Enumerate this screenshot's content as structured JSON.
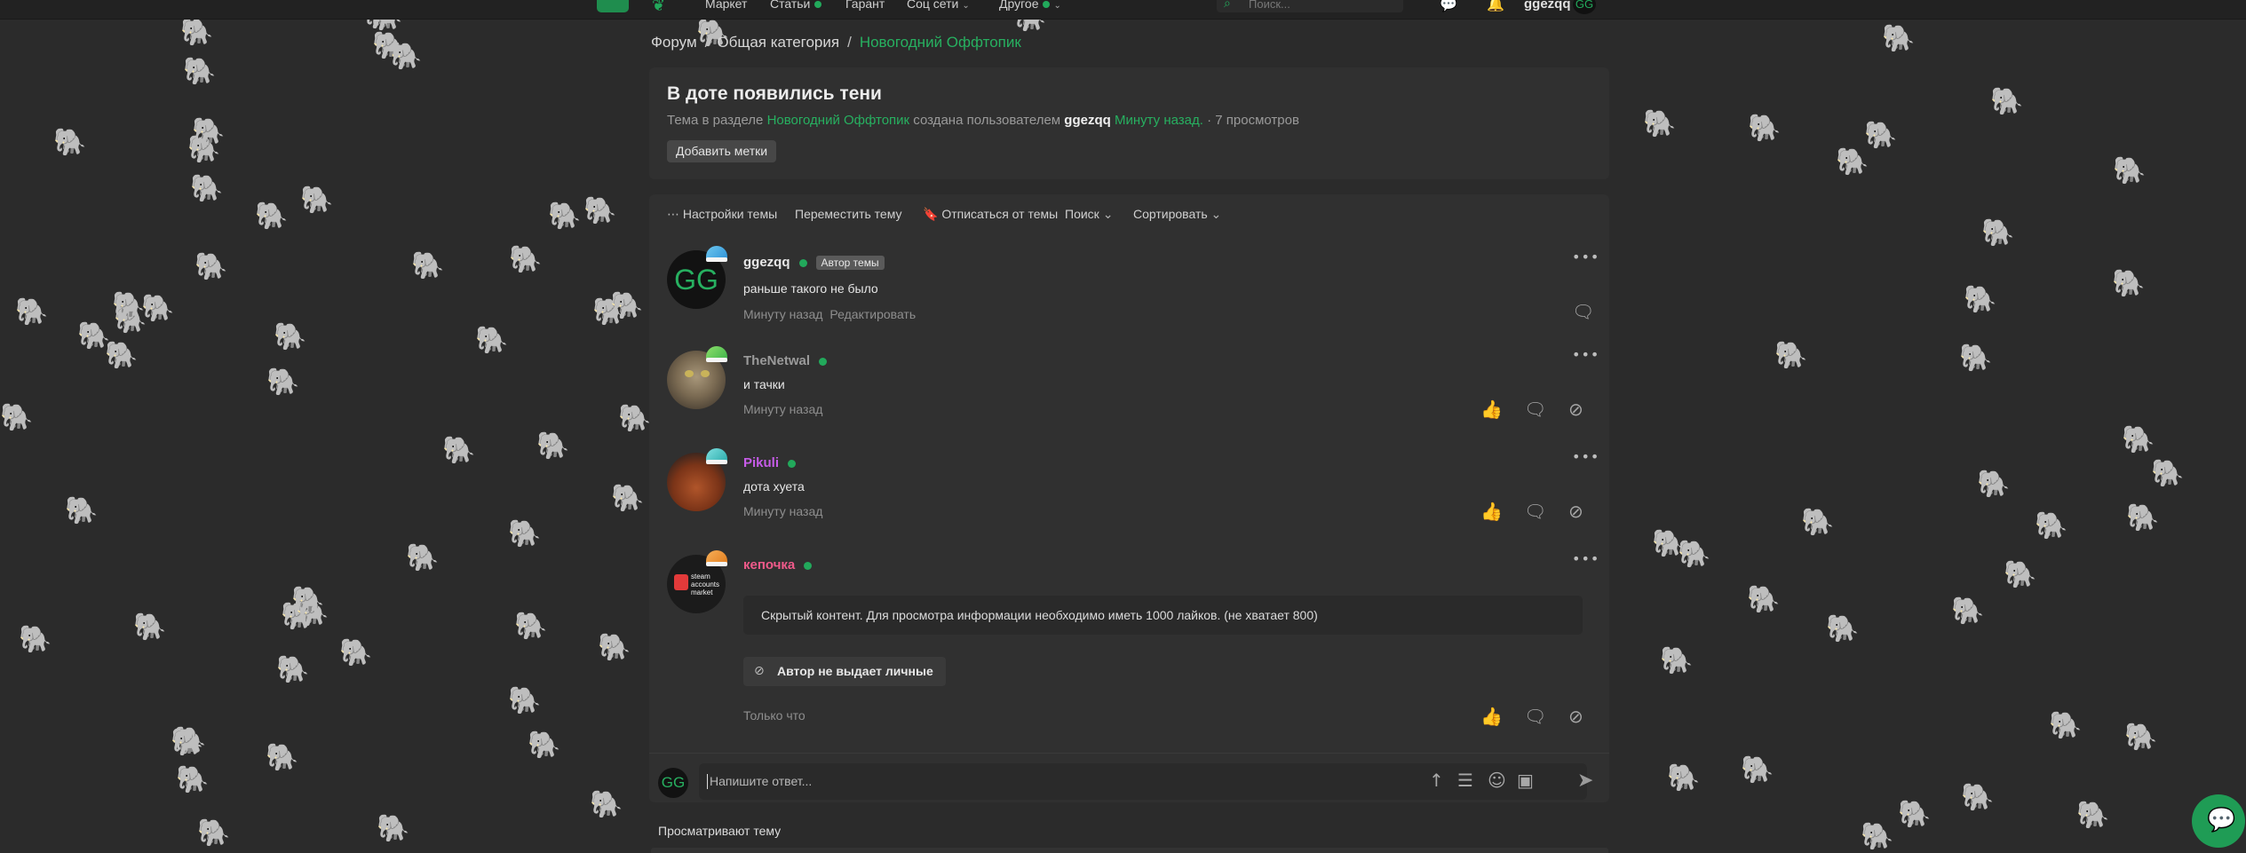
{
  "topbar": {
    "nav": [
      {
        "label": "Маркет",
        "dot": false,
        "chevron": false
      },
      {
        "label": "Статьи",
        "dot": true,
        "chevron": false
      },
      {
        "label": "Гарант",
        "dot": false,
        "chevron": false
      },
      {
        "label": "Соц сети",
        "dot": false,
        "chevron": true
      },
      {
        "label": "Другое",
        "dot": true,
        "chevron": true
      }
    ],
    "search_placeholder": "Поиск...",
    "username": "ggezqq",
    "avatar_text": "GG"
  },
  "breadcrumb": {
    "items": [
      "Форум",
      "Общая категория"
    ],
    "current": "Новогодний Оффтопик",
    "separator": "/"
  },
  "thread": {
    "title": "В доте появились тени",
    "meta_prefix": "Тема в разделе",
    "section": "Новогодний Оффтопик",
    "meta_created": "создана пользователем",
    "author": "ggezqq",
    "time": "Минуту назад.",
    "views": "· 7 просмотров",
    "add_tags": "Добавить метки"
  },
  "toolbar": {
    "settings": "Настройки темы",
    "move": "Переместить тему",
    "unsubscribe": "Отписаться от темы",
    "search": "Поиск",
    "sort": "Сортировать"
  },
  "posts": [
    {
      "username": "ggezqq",
      "name_color": "#e8e8e8",
      "badge": "Автор темы",
      "message": "раньше такого не было",
      "time": "Минуту назад",
      "edit": "Редактировать",
      "avatar_text": "GG",
      "hat": "blue"
    },
    {
      "username": "TheNetwal",
      "name_color": "#9a9a9a",
      "message": "и тачки",
      "time": "Минуту назад",
      "hat": "green"
    },
    {
      "username": "Pikuli",
      "name_color": "#c65ce8",
      "message": "дота хуета",
      "time": "Минуту назад",
      "hat": "teal"
    },
    {
      "username": "кепочка",
      "name_color": "#ef5a8a",
      "hidden_content": "Скрытый контент. Для просмотра информации необходимо иметь 1000 лайков. (не хватает 800)",
      "no_pm": "Автор не выдает личные",
      "time": "Только что",
      "hat": "orange",
      "avatar_lines": [
        "steam",
        "accounts",
        "market"
      ]
    }
  ],
  "reply": {
    "placeholder": "Напишите ответ...",
    "avatar_text": "GG"
  },
  "watching": {
    "label": "Просматривают тему"
  },
  "colors": {
    "accent": "#27b060",
    "background": "#2b2b2b",
    "card": "#303030"
  },
  "icons": [
    "home-icon",
    "logo-icon",
    "search-icon",
    "chat-icon",
    "bell-icon",
    "more-dots-icon",
    "bookmark-icon",
    "chevron-down-icon",
    "like-icon",
    "reply-icon",
    "hide-icon",
    "block-icon",
    "arrow-up-icon",
    "list-icon",
    "emoji-icon",
    "image-icon",
    "send-icon"
  ]
}
